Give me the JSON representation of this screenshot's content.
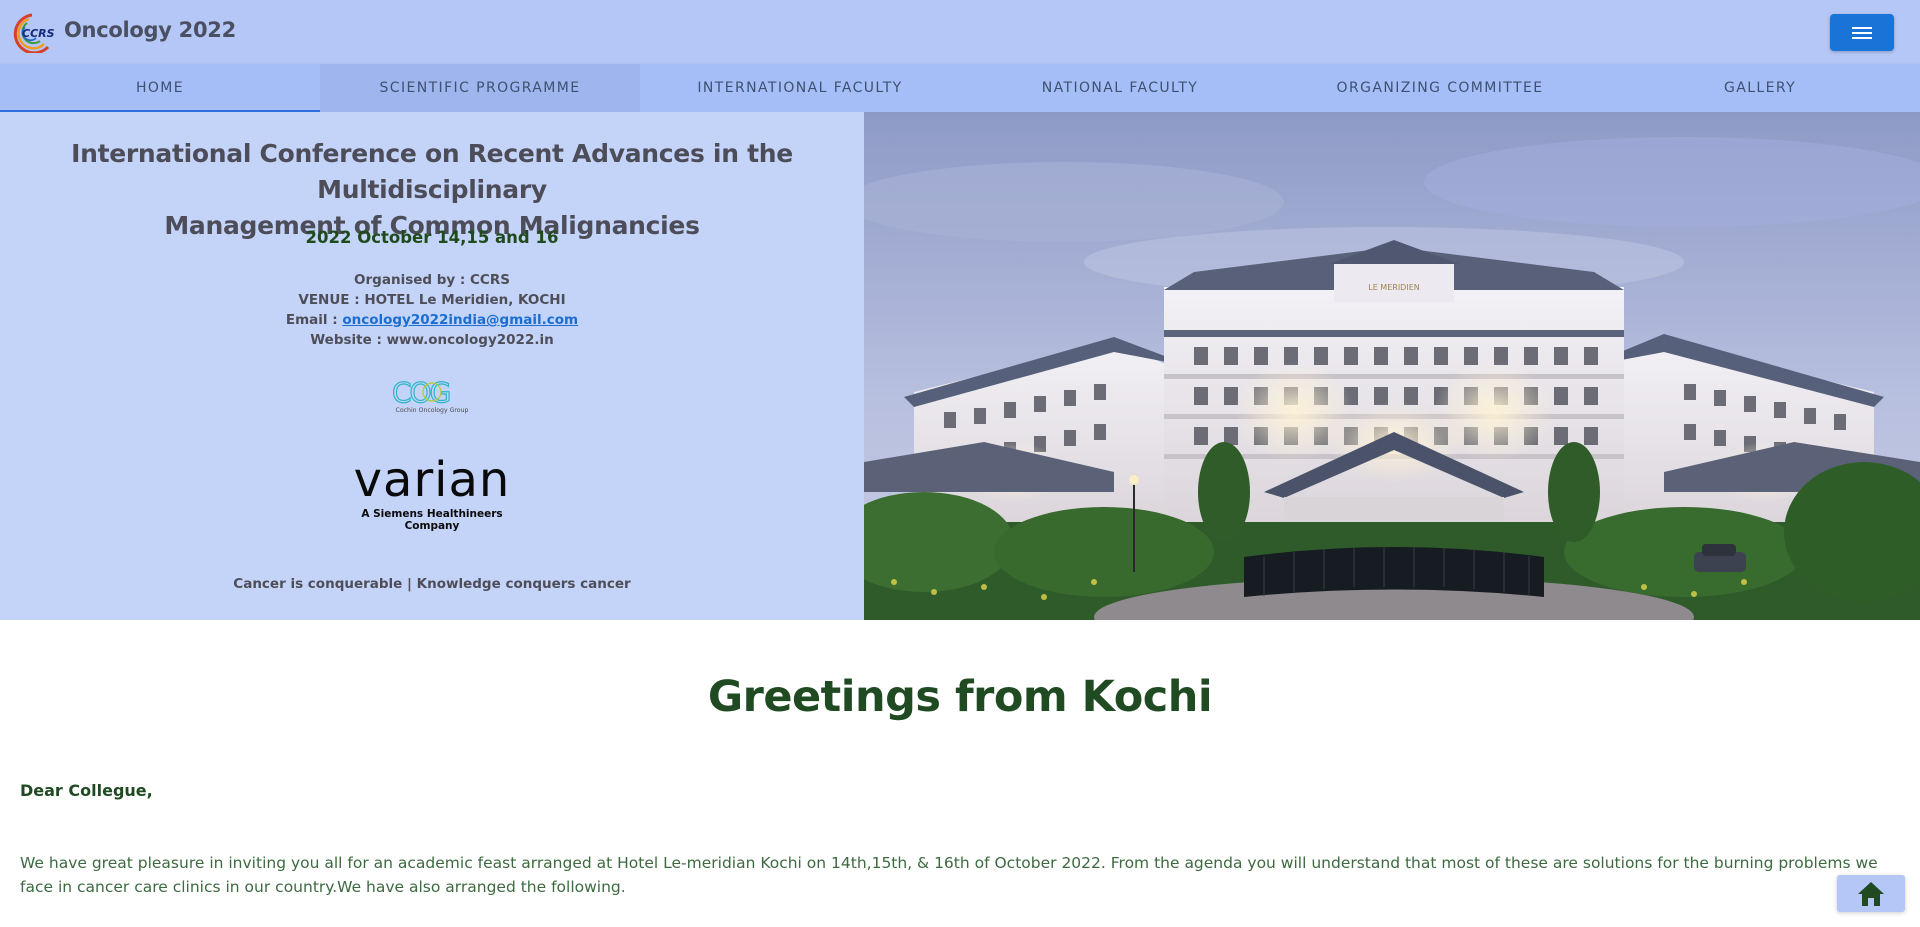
{
  "header": {
    "brand": "Oncology 2022",
    "logo_text": "CCRS",
    "menu_icon": "hamburger-icon"
  },
  "nav": {
    "items": [
      {
        "label": "HOME"
      },
      {
        "label": "SCIENTIFIC PROGRAMME"
      },
      {
        "label": "INTERNATIONAL FACULTY"
      },
      {
        "label": "NATIONAL FACULTY"
      },
      {
        "label": "ORGANIZING COMMITTEE"
      },
      {
        "label": "GALLERY"
      }
    ],
    "active": "HOME"
  },
  "hero": {
    "title_line1": "International Conference on Recent Advances in the Multidisciplinary",
    "title_line2": "Management of Common Malignancies",
    "date": "2022 October 14,15 and 16",
    "organised_by": "Organised by : CCRS",
    "venue": "VENUE : HOTEL Le Meridien, KOCHI",
    "email_label": "Email : ",
    "email": "oncology2022india@gmail.com",
    "website": "Website : www.oncology2022.in",
    "cog_logo_text": "COG",
    "cog_logo_sub": "Cochin Oncology Group",
    "sponsor_name": "varian",
    "sponsor_sub": "A Siemens Healthineers Company",
    "tagline": "Cancer is conquerable | Knowledge conquers cancer",
    "hotel_sign": "LE MERIDIEN"
  },
  "greetings": {
    "title": "Greetings from Kochi",
    "salutation": "Dear Collegue,",
    "paragraph": "We have great pleasure in inviting you all for an academic feast arranged at Hotel Le-meridian Kochi on 14th,15th, & 16th of October 2022. From the agenda you will understand that most of these are solutions for the burning problems we face in cancer care clinics in our country.We have also arranged the following."
  },
  "floating": {
    "home_icon": "home-icon"
  },
  "colors": {
    "header_bg": "#b4c7f7",
    "nav_bg": "#a6bef8",
    "hero_bg": "#c4d3f8",
    "accent_blue": "#1a73d6",
    "green_text": "#1f4a22"
  }
}
